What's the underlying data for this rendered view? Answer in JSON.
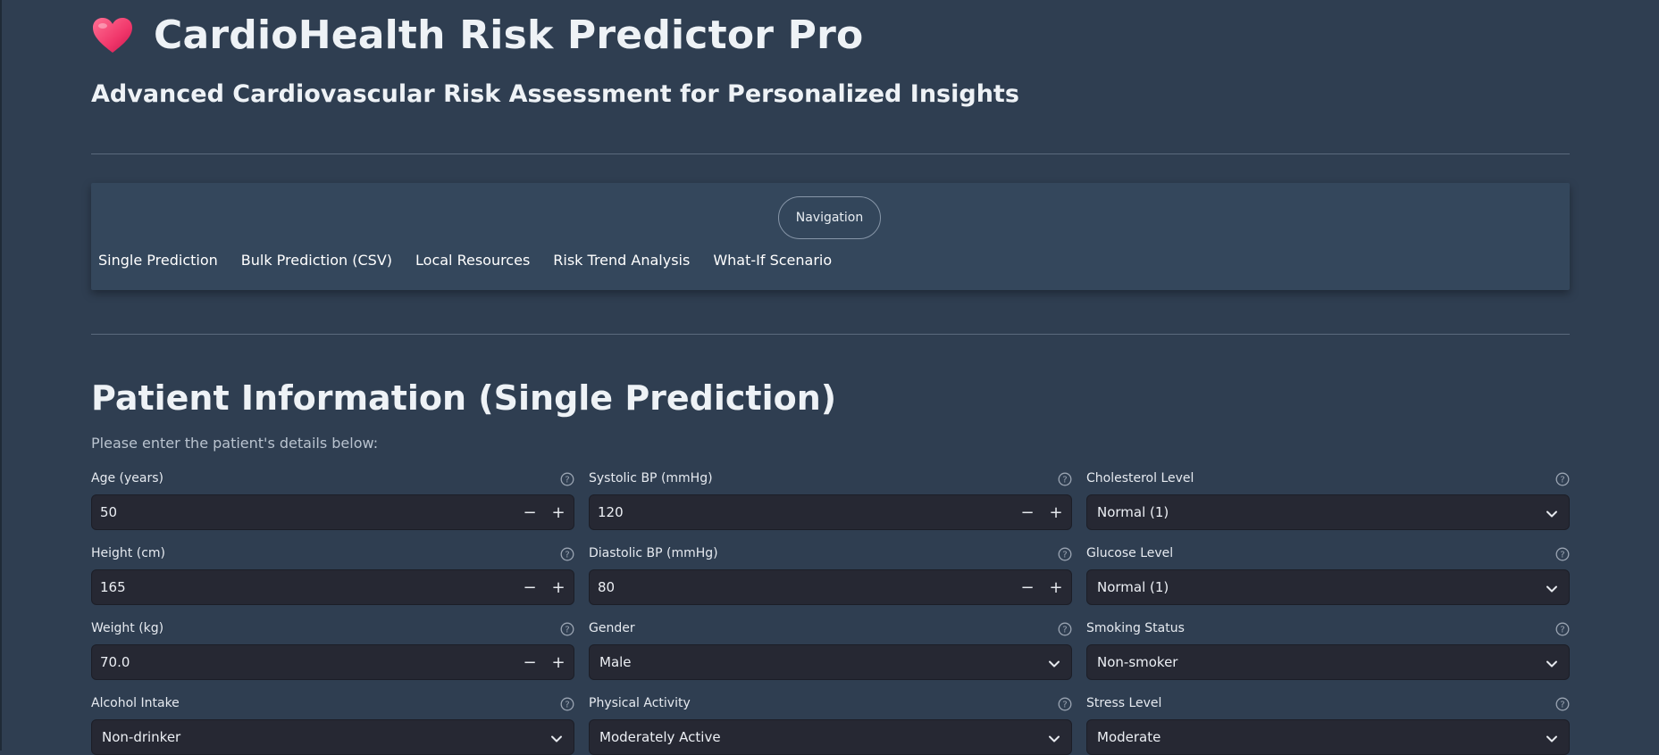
{
  "app": {
    "title": "CardioHealth Risk Predictor Pro",
    "subtitle": "Advanced Cardiovascular Risk Assessment for Personalized Insights",
    "logo_icon": "heart-icon"
  },
  "nav": {
    "pill_label": "Navigation",
    "items": [
      {
        "label": "Single Prediction"
      },
      {
        "label": "Bulk Prediction (CSV)"
      },
      {
        "label": "Local Resources"
      },
      {
        "label": "Risk Trend Analysis"
      },
      {
        "label": "What-If Scenario"
      }
    ]
  },
  "section": {
    "title": "Patient Information (Single Prediction)",
    "description": "Please enter the patient's details below:"
  },
  "fields": {
    "age": {
      "label": "Age (years)",
      "value": "50"
    },
    "systolic": {
      "label": "Systolic BP (mmHg)",
      "value": "120"
    },
    "cholesterol": {
      "label": "Cholesterol Level",
      "value": "Normal (1)"
    },
    "height": {
      "label": "Height (cm)",
      "value": "165"
    },
    "diastolic": {
      "label": "Diastolic BP (mmHg)",
      "value": "80"
    },
    "glucose": {
      "label": "Glucose Level",
      "value": "Normal (1)"
    },
    "weight": {
      "label": "Weight (kg)",
      "value": "70.0"
    },
    "gender": {
      "label": "Gender",
      "value": "Male"
    },
    "smoking": {
      "label": "Smoking Status",
      "value": "Non-smoker"
    },
    "alcohol": {
      "label": "Alcohol Intake",
      "value": "Non-drinker"
    },
    "activity": {
      "label": "Physical Activity",
      "value": "Moderately Active"
    },
    "stress": {
      "label": "Stress Level",
      "value": "Moderate"
    }
  },
  "stepper": {
    "minus": "−",
    "plus": "+"
  },
  "colors": {
    "background": "#2f3e51",
    "panel": "#34475c",
    "input_bg": "#262833",
    "heart": "#f0366a"
  }
}
